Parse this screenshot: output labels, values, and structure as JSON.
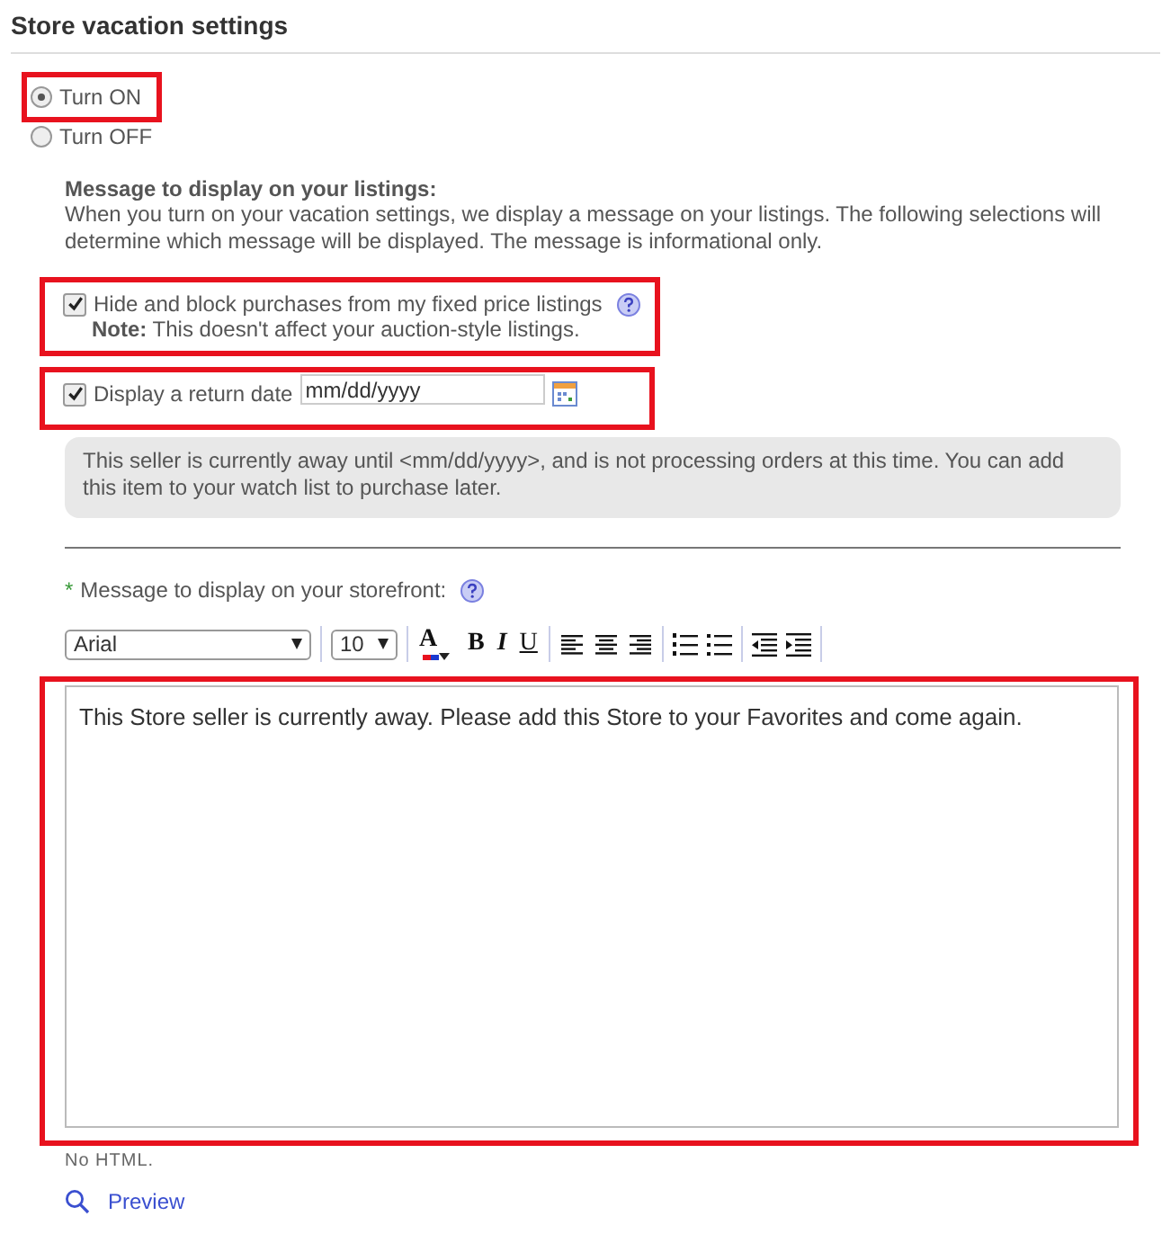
{
  "section_title": "Store vacation settings",
  "vacation_mode": [
    {
      "label": "Turn ON",
      "selected": true,
      "highlighted": true
    },
    {
      "label": "Turn OFF",
      "selected": false,
      "highlighted": false
    }
  ],
  "listings": {
    "heading": "Message to display on your listings:",
    "description": "When you turn on your vacation settings, we display a message on your listings. The following selections will determine which message will be displayed. The message is informational only.",
    "hide_purchases": {
      "label": "Hide and block purchases from my fixed price listings",
      "checked": true,
      "highlighted": true,
      "note": "**Note:** This doesn't affect your auction-style listings."
    },
    "return_date": {
      "label": "Display a return date",
      "checked": true,
      "highlighted": true,
      "value": "mm/dd/yyyy"
    },
    "message": "This seller is currently away until <mm/dd/yyyy>, and is not processing orders at this time. You can add this item to your watch list to purchase later."
  },
  "storefront": {
    "required_mark": "*",
    "label": "Message to display on your storefront:",
    "font": "Arial",
    "size": "10",
    "toolbar": [
      {
        "kind": "text-color",
        "label": "A"
      },
      {
        "kind": "bold",
        "label": "B"
      },
      {
        "kind": "italic",
        "label": "I"
      },
      {
        "kind": "underline",
        "label": "U"
      },
      {
        "kind": "align-left"
      },
      {
        "kind": "align-center"
      },
      {
        "kind": "align-right"
      },
      {
        "kind": "numbered-list"
      },
      {
        "kind": "bullet-list"
      },
      {
        "kind": "outdent"
      },
      {
        "kind": "indent"
      }
    ],
    "message": "This Store seller is currently away. Please add this Store to your Favorites and come again.",
    "highlighted": true,
    "hint": "No HTML.",
    "preview": "Preview"
  }
}
